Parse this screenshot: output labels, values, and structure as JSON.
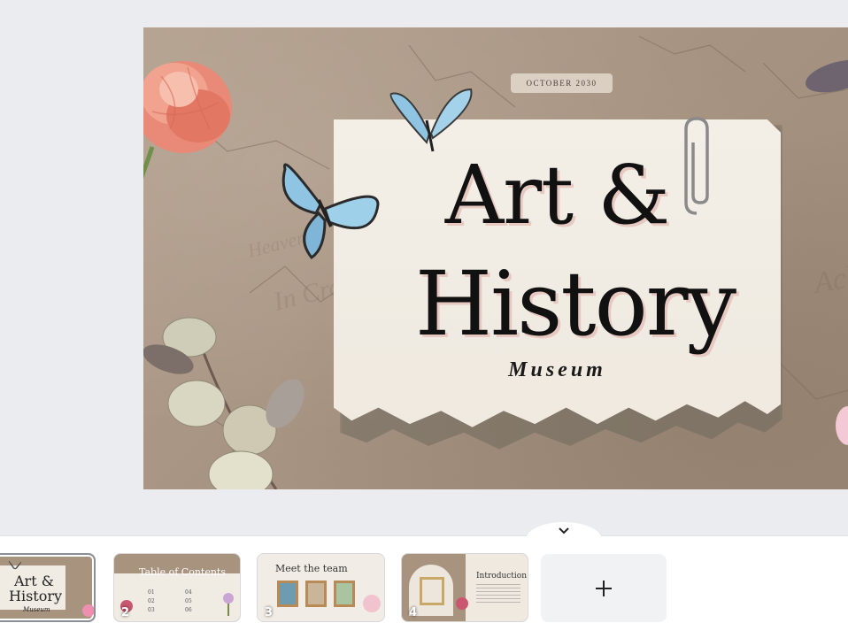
{
  "slide": {
    "date": "OCTOBER 2030",
    "title_line1": "Art &",
    "title_line2": "History",
    "subtitle": "Museum"
  },
  "filmstrip": {
    "collapse_icon": "chevron-down-icon",
    "add_icon": "plus-icon",
    "add_label": "+",
    "thumbnails": [
      {
        "number": "",
        "title_line1": "Art &",
        "title_line2": "History",
        "subtitle": "Museum"
      },
      {
        "number": "2",
        "title": "Table of Contents",
        "items": [
          "01",
          "02",
          "03",
          "04",
          "05",
          "06"
        ]
      },
      {
        "number": "3",
        "title": "Meet the team"
      },
      {
        "number": "4",
        "title": "Introduction"
      }
    ]
  },
  "colors": {
    "background": "#ebecf0",
    "slide_texture": "#a89482",
    "paper": "#f3efe7",
    "title": "#111111",
    "title_shadow": "#e8c9c2",
    "butterfly": "#8fc4e3"
  }
}
